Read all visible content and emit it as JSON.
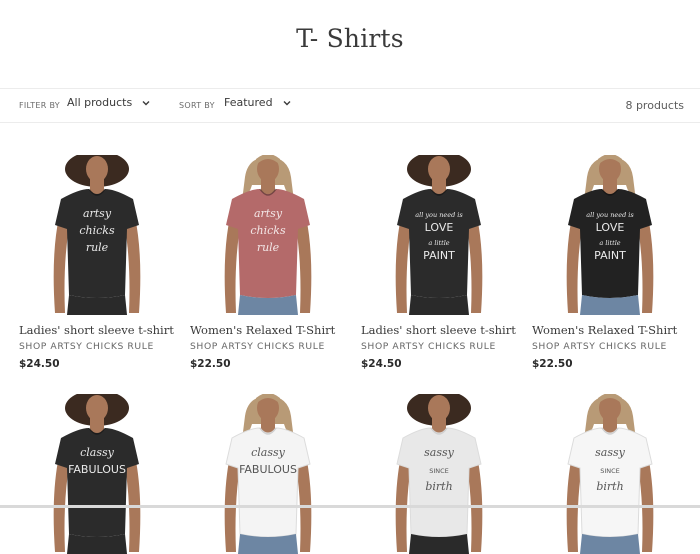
{
  "collection": {
    "title": "T- Shirts"
  },
  "filters": {
    "filter_label": "FILTER BY",
    "filter_value": "All products",
    "sort_label": "SORT BY",
    "sort_value": "Featured",
    "count": "8 products"
  },
  "products": [
    {
      "name": "Ladies' short sleeve t-shirt",
      "vendor": "SHOP ARTSY CHICKS RULE",
      "price": "$24.50",
      "shirt_color": "#2b2b2b",
      "hair": "curly-dark",
      "design_text": [
        "artsy",
        "chicks",
        "rule"
      ]
    },
    {
      "name": "Women's Relaxed T-Shirt",
      "vendor": "SHOP ARTSY CHICKS RULE",
      "price": "$22.50",
      "shirt_color": "#b46a6a",
      "hair": "wavy-blonde",
      "design_text": [
        "artsy",
        "chicks",
        "rule"
      ]
    },
    {
      "name": "Ladies' short sleeve t-shirt",
      "vendor": "SHOP ARTSY CHICKS RULE",
      "price": "$24.50",
      "shirt_color": "#2b2b2b",
      "hair": "curly-dark",
      "design_text": [
        "all you need is",
        "LOVE",
        "a little",
        "PAINT"
      ]
    },
    {
      "name": "Women's Relaxed T-Shirt",
      "vendor": "SHOP ARTSY CHICKS RULE",
      "price": "$22.50",
      "shirt_color": "#222222",
      "hair": "wavy-blonde",
      "design_text": [
        "all you need is",
        "LOVE",
        "a little",
        "PAINT"
      ]
    },
    {
      "shirt_color": "#2b2b2b",
      "hair": "curly-dark",
      "design_text": [
        "classy",
        "FABULOUS"
      ]
    },
    {
      "shirt_color": "#f4f4f4",
      "hair": "wavy-blonde",
      "design_text": [
        "classy",
        "FABULOUS"
      ]
    },
    {
      "shirt_color": "#e8e8e8",
      "hair": "curly-dark",
      "design_text": [
        "sassy",
        "SINCE",
        "birth"
      ]
    },
    {
      "shirt_color": "#f6f6f6",
      "hair": "wavy-blonde",
      "design_text": [
        "sassy",
        "SINCE",
        "birth"
      ]
    }
  ]
}
